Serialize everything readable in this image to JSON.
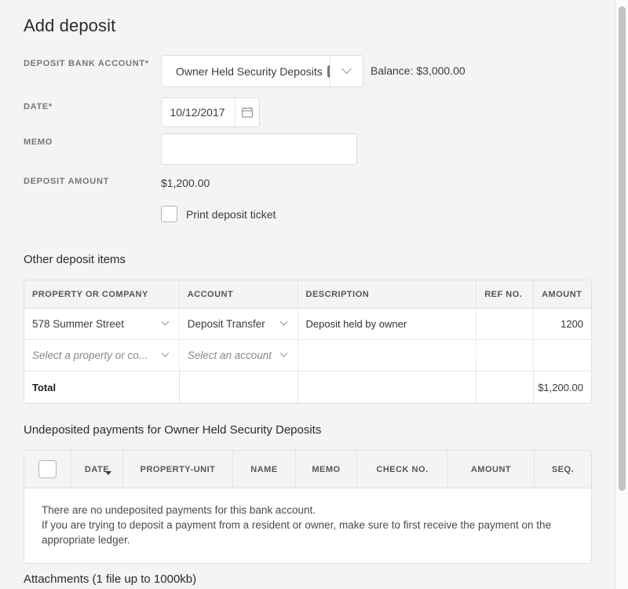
{
  "page": {
    "title": "Add deposit"
  },
  "form": {
    "bank_account": {
      "label": "DEPOSIT BANK ACCOUNT*",
      "value": "Owner Held Security Deposits",
      "badge_icon": "ellipsis-badge-icon",
      "chevron_icon": "chevron-down-icon",
      "balance": "Balance: $3,000.00"
    },
    "date": {
      "label": "DATE*",
      "value": "10/12/2017",
      "calendar_icon": "calendar-icon"
    },
    "memo": {
      "label": "MEMO",
      "value": "",
      "placeholder": ""
    },
    "deposit_amount": {
      "label": "DEPOSIT AMOUNT",
      "value": "$1,200.00"
    },
    "print_ticket": {
      "label": "Print deposit ticket",
      "checked": false
    }
  },
  "other_items": {
    "section_title": "Other deposit items",
    "columns": [
      "PROPERTY OR COMPANY",
      "ACCOUNT",
      "DESCRIPTION",
      "REF NO.",
      "AMOUNT"
    ],
    "rows": [
      {
        "property": "578 Summer Street",
        "property_is_placeholder": false,
        "account": "Deposit Transfer",
        "account_is_placeholder": false,
        "description": "Deposit held by owner",
        "ref_no": "",
        "amount": "1200"
      },
      {
        "property": "Select a property or co...",
        "property_is_placeholder": true,
        "account": "Select an account",
        "account_is_placeholder": true,
        "description": "",
        "ref_no": "",
        "amount": ""
      }
    ],
    "total_label": "Total",
    "total_amount": "$1,200.00"
  },
  "undeposited": {
    "section_title": "Undeposited payments for Owner Held Security Deposits",
    "select_all_checked": false,
    "columns": [
      "DATE",
      "PROPERTY-UNIT",
      "NAME",
      "MEMO",
      "CHECK NO.",
      "AMOUNT",
      "SEQ."
    ],
    "sorted_column": "DATE",
    "sort_direction": "desc",
    "empty_line_1": "There are no undeposited payments for this bank account.",
    "empty_line_2": "If you are trying to deposit a payment from a resident or owner, make sure to first receive the payment on the appropriate ledger."
  },
  "attachments": {
    "section_title": "Attachments (1 file up to 1000kb)"
  },
  "colors": {
    "background": "#f4f4f4",
    "surface": "#ffffff",
    "border": "#e0e0e0",
    "label": "#777777",
    "text": "#3c3c3c",
    "badge": "#767676",
    "scrollbar_thumb": "#c2c2c2"
  }
}
